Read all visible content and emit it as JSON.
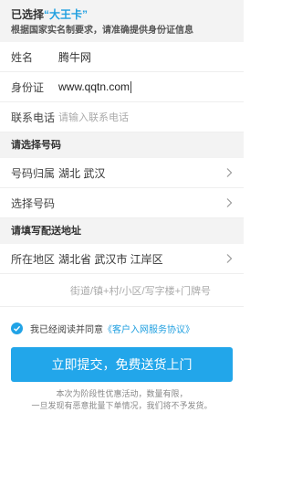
{
  "header": {
    "selected_prefix": "已选择",
    "card_name": "“大王卡”",
    "notice": "根据国家实名制要求，请准确提供身份证信息"
  },
  "form": {
    "name_label": "姓名",
    "name_value": "腾牛网",
    "id_label": "身份证",
    "id_value": "www.qqtn.com",
    "phone_label": "联系电话",
    "phone_placeholder": "请输入联系电话"
  },
  "number_section": {
    "title": "请选择号码",
    "location_label": "号码归属",
    "location_value": "湖北 武汉",
    "choose_label": "选择号码",
    "choose_value": ""
  },
  "address_section": {
    "title": "请填写配送地址",
    "region_label": "所在地区",
    "region_value": "湖北省 武汉市 江岸区",
    "detail_placeholder": "街道/镇+村/小区/写字楼+门牌号"
  },
  "agreement": {
    "text": "我已经阅读并同意",
    "link": "《客户入网服务协议》"
  },
  "submit": {
    "label": "立即提交，免费送货上门"
  },
  "footer_note": {
    "line1": "本次为阶段性优惠活动，数量有限，",
    "line2": "一旦发现有恶意批量下单情况，我们将不予发货。"
  },
  "colors": {
    "accent": "#22a6ea",
    "background_gray": "#f3f3f3"
  }
}
